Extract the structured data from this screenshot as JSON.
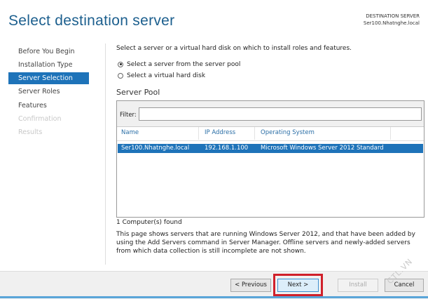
{
  "title": "Select destination server",
  "destination": {
    "label": "DESTINATION SERVER",
    "server": "Ser100.Nhatnghe.local"
  },
  "nav": [
    {
      "label": "Before You Begin",
      "state": "normal"
    },
    {
      "label": "Installation Type",
      "state": "normal"
    },
    {
      "label": "Server Selection",
      "state": "selected"
    },
    {
      "label": "Server Roles",
      "state": "normal"
    },
    {
      "label": "Features",
      "state": "normal"
    },
    {
      "label": "Confirmation",
      "state": "disabled"
    },
    {
      "label": "Results",
      "state": "disabled"
    }
  ],
  "intro": "Select a server or a virtual hard disk on which to install roles and features.",
  "options": [
    {
      "label": "Select a server from the server pool",
      "checked": true
    },
    {
      "label": "Select a virtual hard disk",
      "checked": false
    }
  ],
  "pool": {
    "label": "Server Pool",
    "filter_label": "Filter:",
    "filter_value": "",
    "columns": [
      "Name",
      "IP Address",
      "Operating System"
    ],
    "rows": [
      {
        "name": "Ser100.Nhatnghe.local",
        "ip": "192.168.1.100",
        "os": "Microsoft Windows Server 2012 Standard",
        "selected": true
      }
    ]
  },
  "found": "1 Computer(s) found",
  "info": "This page shows servers that are running Windows Server 2012, and that have been added by using the Add Servers command in Server Manager. Offline servers and newly-added servers from which data collection is still incomplete are not shown.",
  "buttons": {
    "previous": "< Previous",
    "next": "Next >",
    "install": "Install",
    "cancel": "Cancel"
  },
  "watermark": "CTL.VN",
  "colors": {
    "accent": "#1e73b9",
    "highlight": "#d0202a"
  }
}
